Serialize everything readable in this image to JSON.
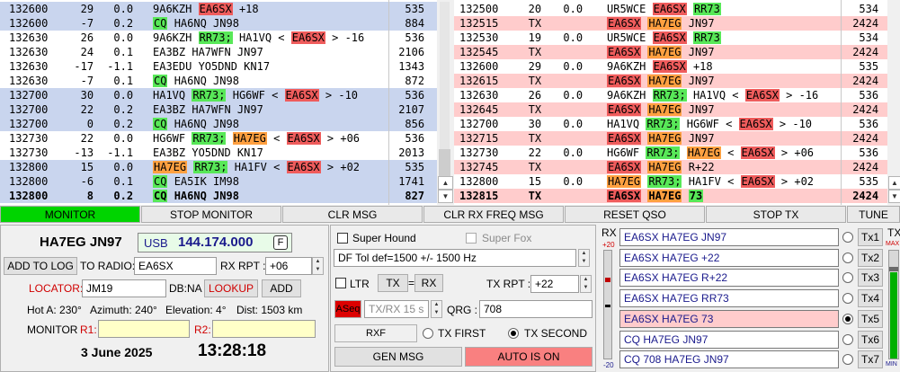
{
  "left_log": [
    {
      "t": "132600",
      "db": "29",
      "dt": "0.0",
      "msg": [
        [
          "9A6KZH",
          ""
        ],
        [
          "EA6SX",
          "red"
        ],
        [
          "+18",
          ""
        ]
      ],
      "f": "535",
      "bg": "#c9d5ee"
    },
    {
      "t": "132600",
      "db": "-7",
      "dt": "0.2",
      "msg": [
        [
          "CQ",
          "green"
        ],
        [
          "HA6NQ JN98",
          ""
        ]
      ],
      "f": "884",
      "bg": "#c9d5ee"
    },
    {
      "t": "132630",
      "db": "26",
      "dt": "0.0",
      "msg": [
        [
          "9A6KZH",
          ""
        ],
        [
          "RR73;",
          "green"
        ],
        [
          "HA1VQ <",
          ""
        ],
        [
          "EA6SX",
          "red"
        ],
        [
          "> -16",
          ""
        ]
      ],
      "f": "536",
      "bg": "#ffffff"
    },
    {
      "t": "132630",
      "db": "24",
      "dt": "0.1",
      "msg": [
        [
          "EA3BZ HA7WFN JN97",
          ""
        ]
      ],
      "f": "2106",
      "bg": "#ffffff"
    },
    {
      "t": "132630",
      "db": "-17",
      "dt": "-1.1",
      "msg": [
        [
          "EA3EDU YO5DND KN17",
          ""
        ]
      ],
      "f": "1343",
      "bg": "#ffffff"
    },
    {
      "t": "132630",
      "db": "-7",
      "dt": "0.1",
      "msg": [
        [
          "CQ",
          "green"
        ],
        [
          "HA6NQ JN98",
          ""
        ]
      ],
      "f": "872",
      "bg": "#ffffff"
    },
    {
      "t": "132700",
      "db": "30",
      "dt": "0.0",
      "msg": [
        [
          "HA1VQ",
          ""
        ],
        [
          "RR73;",
          "green"
        ],
        [
          "HG6WF <",
          ""
        ],
        [
          "EA6SX",
          "red"
        ],
        [
          "> -10",
          ""
        ]
      ],
      "f": "536",
      "bg": "#c9d5ee"
    },
    {
      "t": "132700",
      "db": "22",
      "dt": "0.2",
      "msg": [
        [
          "EA3BZ HA7WFN JN97",
          ""
        ]
      ],
      "f": "2107",
      "bg": "#c9d5ee"
    },
    {
      "t": "132700",
      "db": "0",
      "dt": "0.2",
      "msg": [
        [
          "CQ",
          "green"
        ],
        [
          "HA6NQ JN98",
          ""
        ]
      ],
      "f": "856",
      "bg": "#c9d5ee"
    },
    {
      "t": "132730",
      "db": "22",
      "dt": "0.0",
      "msg": [
        [
          "HG6WF",
          ""
        ],
        [
          "RR73;",
          "green"
        ],
        [
          "HA7EG",
          "orange"
        ],
        [
          "<",
          ""
        ],
        [
          "EA6SX",
          "red"
        ],
        [
          "> +06",
          ""
        ]
      ],
      "f": "536",
      "bg": "#ffffff"
    },
    {
      "t": "132730",
      "db": "-13",
      "dt": "-1.1",
      "msg": [
        [
          "EA3BZ YO5DND KN17",
          ""
        ]
      ],
      "f": "2013",
      "bg": "#ffffff"
    },
    {
      "t": "132800",
      "db": "15",
      "dt": "0.0",
      "msg": [
        [
          "HA7EG",
          "orange"
        ],
        [
          "RR73;",
          "green"
        ],
        [
          "HA1FV <",
          ""
        ],
        [
          "EA6SX",
          "red"
        ],
        [
          "> +02",
          ""
        ]
      ],
      "f": "535",
      "bg": "#c9d5ee"
    },
    {
      "t": "132800",
      "db": "-6",
      "dt": "0.1",
      "msg": [
        [
          "CQ",
          "green"
        ],
        [
          "EA5IK IM98",
          ""
        ]
      ],
      "f": "1741",
      "bg": "#c9d5ee"
    },
    {
      "t": "132800",
      "db": "8",
      "dt": "0.2",
      "msg": [
        [
          "CQ",
          "green"
        ],
        [
          "HA6NQ JN98",
          ""
        ]
      ],
      "f": "827",
      "bg": "#c9d5ee",
      "bold": true
    }
  ],
  "right_log": [
    {
      "t": "132500",
      "db": "20",
      "dt": "0.0",
      "msg": [
        [
          "UR5WCE",
          ""
        ],
        [
          "EA6SX",
          "red"
        ],
        [
          "RR73",
          "green"
        ]
      ],
      "f": "534",
      "bg": "#ffffff"
    },
    {
      "t": "132515",
      "db": "TX",
      "dt": "",
      "msg": [
        [
          "EA6SX",
          "red"
        ],
        [
          "HA7EG",
          "orange"
        ],
        [
          "JN97",
          ""
        ]
      ],
      "f": "2424",
      "bg": "#ffcccc"
    },
    {
      "t": "132530",
      "db": "19",
      "dt": "0.0",
      "msg": [
        [
          "UR5WCE",
          ""
        ],
        [
          "EA6SX",
          "red"
        ],
        [
          "RR73",
          "green"
        ]
      ],
      "f": "534",
      "bg": "#ffffff"
    },
    {
      "t": "132545",
      "db": "TX",
      "dt": "",
      "msg": [
        [
          "EA6SX",
          "red"
        ],
        [
          "HA7EG",
          "orange"
        ],
        [
          "JN97",
          ""
        ]
      ],
      "f": "2424",
      "bg": "#ffcccc"
    },
    {
      "t": "132600",
      "db": "29",
      "dt": "0.0",
      "msg": [
        [
          "9A6KZH",
          ""
        ],
        [
          "EA6SX",
          "red"
        ],
        [
          "+18",
          ""
        ]
      ],
      "f": "535",
      "bg": "#ffffff"
    },
    {
      "t": "132615",
      "db": "TX",
      "dt": "",
      "msg": [
        [
          "EA6SX",
          "red"
        ],
        [
          "HA7EG",
          "orange"
        ],
        [
          "JN97",
          ""
        ]
      ],
      "f": "2424",
      "bg": "#ffcccc"
    },
    {
      "t": "132630",
      "db": "26",
      "dt": "0.0",
      "msg": [
        [
          "9A6KZH",
          ""
        ],
        [
          "RR73;",
          "green"
        ],
        [
          "HA1VQ <",
          ""
        ],
        [
          "EA6SX",
          "red"
        ],
        [
          "> -16",
          ""
        ]
      ],
      "f": "536",
      "bg": "#ffffff"
    },
    {
      "t": "132645",
      "db": "TX",
      "dt": "",
      "msg": [
        [
          "EA6SX",
          "red"
        ],
        [
          "HA7EG",
          "orange"
        ],
        [
          "JN97",
          ""
        ]
      ],
      "f": "2424",
      "bg": "#ffcccc"
    },
    {
      "t": "132700",
      "db": "30",
      "dt": "0.0",
      "msg": [
        [
          "HA1VQ",
          ""
        ],
        [
          "RR73;",
          "green"
        ],
        [
          "HG6WF <",
          ""
        ],
        [
          "EA6SX",
          "red"
        ],
        [
          "> -10",
          ""
        ]
      ],
      "f": "536",
      "bg": "#ffffff"
    },
    {
      "t": "132715",
      "db": "TX",
      "dt": "",
      "msg": [
        [
          "EA6SX",
          "red"
        ],
        [
          "HA7EG",
          "orange"
        ],
        [
          "JN97",
          ""
        ]
      ],
      "f": "2424",
      "bg": "#ffcccc"
    },
    {
      "t": "132730",
      "db": "22",
      "dt": "0.0",
      "msg": [
        [
          "HG6WF",
          ""
        ],
        [
          "RR73;",
          "green"
        ],
        [
          "HA7EG",
          "orange"
        ],
        [
          "<",
          ""
        ],
        [
          "EA6SX",
          "red"
        ],
        [
          "> +06",
          ""
        ]
      ],
      "f": "536",
      "bg": "#ffffff"
    },
    {
      "t": "132745",
      "db": "TX",
      "dt": "",
      "msg": [
        [
          "EA6SX",
          "red"
        ],
        [
          "HA7EG",
          "orange"
        ],
        [
          "R+22",
          ""
        ]
      ],
      "f": "2424",
      "bg": "#ffcccc"
    },
    {
      "t": "132800",
      "db": "15",
      "dt": "0.0",
      "msg": [
        [
          "HA7EG",
          "orange"
        ],
        [
          "RR73;",
          "green"
        ],
        [
          "HA1FV <",
          ""
        ],
        [
          "EA6SX",
          "red"
        ],
        [
          "> +02",
          ""
        ]
      ],
      "f": "535",
      "bg": "#ffffff"
    },
    {
      "t": "132815",
      "db": "TX",
      "dt": "",
      "msg": [
        [
          "EA6SX",
          "red"
        ],
        [
          "HA7EG",
          "orange"
        ],
        [
          "73",
          "green"
        ]
      ],
      "f": "2424",
      "bg": "#ffcccc",
      "bold": true
    }
  ],
  "buttons": {
    "monitor": "MONITOR",
    "stop_monitor": "STOP MONITOR",
    "clr_msg": "CLR MSG",
    "clr_rx_freq_msg": "CLR RX FREQ MSG",
    "reset_qso": "RESET QSO",
    "stop_tx": "STOP TX",
    "tune": "TUNE"
  },
  "station": {
    "call_grid": "HA7EG JN97",
    "mode": "USB",
    "freq": "144.174.000",
    "f_btn": "F",
    "add_to_log": "ADD TO LOG",
    "to_radio_label": "TO RADIO:",
    "to_radio_value": "EA6SX",
    "rx_rpt_label": "RX RPT :",
    "rx_rpt_value": "+06",
    "locator_label": "LOCATOR:",
    "locator_value": "JM19",
    "db_label": "DB:NA",
    "lookup": "LOOKUP",
    "add": "ADD",
    "hot_a": "Hot A: 230°",
    "azimuth": "Azimuth: 240°",
    "elevation": "Elevation: 4°",
    "dist": "Dist: 1503 km",
    "monitor_label": "MONITOR",
    "r1_label": "R1:",
    "r2_label": "R2:",
    "date": "3 June 2025",
    "time": "13:28:18"
  },
  "controls": {
    "super_hound": "Super Hound",
    "super_fox": "Super Fox",
    "df_tol": "DF Tol def=1500 +/-  1500  Hz",
    "ltr": "LTR",
    "tx": "TX",
    "eq": "=",
    "rx": "RX",
    "tx_rpt_label": "TX RPT :",
    "tx_rpt_value": "+22",
    "aseq": "ASeq",
    "txrx": "TX/RX 15  s",
    "qrg_label": "QRG :",
    "qrg_value": "708",
    "rxf": "RXF",
    "tx_first": "TX FIRST",
    "tx_second": "TX SECOND",
    "gen_msg": "GEN MSG",
    "auto_is_on": "AUTO IS ON"
  },
  "meters": {
    "rx_label": "RX",
    "rx_top": "+20",
    "rx_bottom": "-20",
    "tx_label": "TX",
    "tx_top": "MAX",
    "tx_bottom": "MIN"
  },
  "tx_msgs": [
    {
      "text": "EA6SX HA7EG JN97",
      "btn": "Tx1",
      "sel": false,
      "highlight": false
    },
    {
      "text": "EA6SX HA7EG +22",
      "btn": "Tx2",
      "sel": false,
      "highlight": false
    },
    {
      "text": "EA6SX HA7EG R+22",
      "btn": "Tx3",
      "sel": false,
      "highlight": false
    },
    {
      "text": "EA6SX HA7EG RR73",
      "btn": "Tx4",
      "sel": false,
      "highlight": false
    },
    {
      "text": "EA6SX HA7EG 73",
      "btn": "Tx5",
      "sel": true,
      "highlight": true
    },
    {
      "text": "CQ HA7EG JN97",
      "btn": "Tx6",
      "sel": false,
      "highlight": false
    },
    {
      "text": "CQ 708 HA7EG JN97",
      "btn": "Tx7",
      "sel": false,
      "highlight": false
    }
  ],
  "colors": {
    "monitor_on": "#00d400",
    "auto_on": "#f98080",
    "aseq": "#dd0000",
    "tx5_bg": "#ffcccc",
    "freq": "#1a1a8c"
  }
}
